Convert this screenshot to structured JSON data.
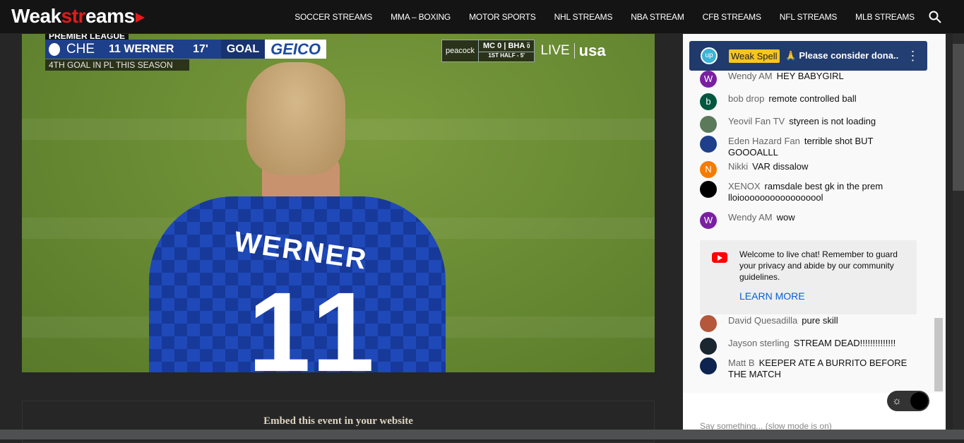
{
  "header": {
    "logo": {
      "part1": "Weak",
      "part2": "str",
      "part3": "eams"
    },
    "nav": [
      "SOCCER STREAMS",
      "MMA – BOXING",
      "MOTOR SPORTS",
      "NHL STREAMS",
      "NBA STREAM",
      "CFB STREAMS",
      "NFL STREAMS",
      "MLB STREAMS"
    ],
    "search_icon": "search-icon"
  },
  "video": {
    "league": "PREMIER LEAGUE",
    "team": "CHE",
    "player": "11 WERNER",
    "minute": "17'",
    "event": "GOAL",
    "sponsor": "GEICO",
    "subtitle": "4TH GOAL IN PL THIS SEASON",
    "broadcaster": "peacock",
    "home": "MC",
    "home_score": "0",
    "away": "BHA",
    "away_score": "0",
    "period": "1ST HALF - 5'",
    "live": "LIVE",
    "network": "usa",
    "jersey_name": "WERNER",
    "jersey_number": "11"
  },
  "embed": {
    "label": "Embed this event in your website"
  },
  "chat": {
    "pinned": {
      "author": "Weak Spell",
      "message": "🙏 Please consider dona..."
    },
    "messages": [
      {
        "author": "Wendy AM",
        "text": "HEY BABYGIRL",
        "initial": "W",
        "color": "#7b1fa2"
      },
      {
        "author": "bob drop",
        "text": "remote controlled ball",
        "initial": "b",
        "color": "#00573f"
      },
      {
        "author": "Yeovil Fan TV",
        "text": "styreen is not loading",
        "initial": "",
        "color": "#5a7a5a"
      },
      {
        "author": "Eden Hazard Fan",
        "text": "terrible shot BUT GOOOALLL",
        "initial": "",
        "color": "#1e3f8a"
      },
      {
        "author": "Nikki",
        "text": "VAR dissalow",
        "initial": "N",
        "color": "#f57c00"
      },
      {
        "author": "XENOX",
        "text": "ramsdale best gk in the prem lloiooooooooooooooool",
        "initial": "",
        "color": "#000000"
      },
      {
        "author": "Wendy AM",
        "text": "wow",
        "initial": "W",
        "color": "#7b1fa2"
      },
      {
        "author": "David Quesadilla",
        "text": "pure skill",
        "initial": "",
        "color": "#b5573a"
      },
      {
        "author": "Jayson sterling",
        "text": "STREAM DEAD!!!!!!!!!!!!!!",
        "initial": "",
        "color": "#1a2630"
      },
      {
        "author": "Matt B",
        "text": "KEEPER ATE A BURRITO BEFORE THE MATCH",
        "initial": "",
        "color": "#0d2350"
      }
    ],
    "welcome": {
      "text": "Welcome to live chat! Remember to guard your privacy and abide by our community guidelines.",
      "link": "LEARN MORE"
    },
    "input_placeholder": "Say something... (slow mode is on)"
  }
}
